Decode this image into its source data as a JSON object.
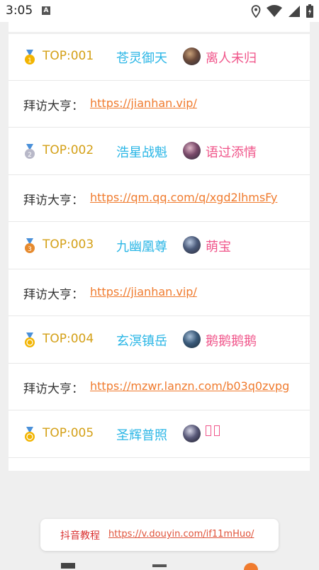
{
  "status_bar": {
    "time": "3:05",
    "notification_icon": "A"
  },
  "entries": [
    {
      "rank": "TOP:001",
      "title": "苍灵御天",
      "user": "离人未归",
      "visit_label": "拜访大亨：",
      "link": "https://jianhan.vip/",
      "medal_color": "#f2b400"
    },
    {
      "rank": "TOP:002",
      "title": "浩星战魁",
      "user": "语过添情",
      "visit_label": "拜访大亨：",
      "link": "https://qm.qq.com/q/xgd2lhmsFy",
      "medal_color": "#b8b8c8"
    },
    {
      "rank": "TOP:003",
      "title": "九幽凰尊",
      "user": "萌宝",
      "visit_label": "拜访大亨：",
      "link": "https://jianhan.vip/",
      "medal_color": "#e68a2e"
    },
    {
      "rank": "TOP:004",
      "title": "玄溟镇岳",
      "user": "鹅鹅鹅鹅",
      "visit_label": "拜访大亨：",
      "link": "https://mzwr.lanzn.com/b03q0zvpg",
      "medal_color": "#f2b400"
    },
    {
      "rank": "TOP:005",
      "title": "圣辉普照",
      "user": "",
      "visit_label": "",
      "link": "",
      "medal_color": "#f2b400"
    }
  ],
  "footer": {
    "label": "抖音教程",
    "link": "https://v.douyin.com/if11mHuo/"
  },
  "colors": {
    "rank": "#d4a017",
    "title": "#2ab6e6",
    "user": "#f0558a",
    "link": "#f07b2e"
  }
}
